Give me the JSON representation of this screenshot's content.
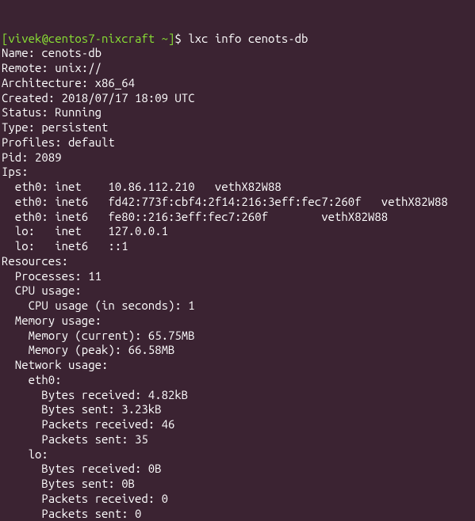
{
  "prompt": {
    "user_host": "[vivek@centos7-nixcraft ~]",
    "dollar": "$ ",
    "command": "lxc info cenots-db"
  },
  "output": {
    "name": "Name: cenots-db",
    "remote": "Remote: unix://",
    "arch": "Architecture: x86_64",
    "created": "Created: 2018/07/17 18:09 UTC",
    "status": "Status: Running",
    "type": "Type: persistent",
    "profiles": "Profiles: default",
    "pid": "Pid: 2089",
    "ips_header": "Ips:",
    "ip_eth0_inet": "  eth0: inet    10.86.112.210   vethX82W88",
    "ip_eth0_inet6a": "  eth0: inet6   fd42:773f:cbf4:2f14:216:3eff:fec7:260f   vethX82W88",
    "ip_eth0_inet6b": "  eth0: inet6   fe80::216:3eff:fec7:260f        vethX82W88",
    "ip_lo_inet": "  lo:   inet    127.0.0.1",
    "ip_lo_inet6": "  lo:   inet6   ::1",
    "resources_header": "Resources:",
    "processes": "  Processes: 11",
    "cpu_header": "  CPU usage:",
    "cpu_seconds": "    CPU usage (in seconds): 1",
    "mem_header": "  Memory usage:",
    "mem_current": "    Memory (current): 65.75MB",
    "mem_peak": "    Memory (peak): 66.58MB",
    "net_header": "  Network usage:",
    "net_eth0": "    eth0:",
    "net_eth0_br": "      Bytes received: 4.82kB",
    "net_eth0_bs": "      Bytes sent: 3.23kB",
    "net_eth0_pr": "      Packets received: 46",
    "net_eth0_ps": "      Packets sent: 35",
    "net_lo": "    lo:",
    "net_lo_br": "      Bytes received: 0B",
    "net_lo_bs": "      Bytes sent: 0B",
    "net_lo_pr": "      Packets received: 0",
    "net_lo_ps": "      Packets sent: 0"
  }
}
